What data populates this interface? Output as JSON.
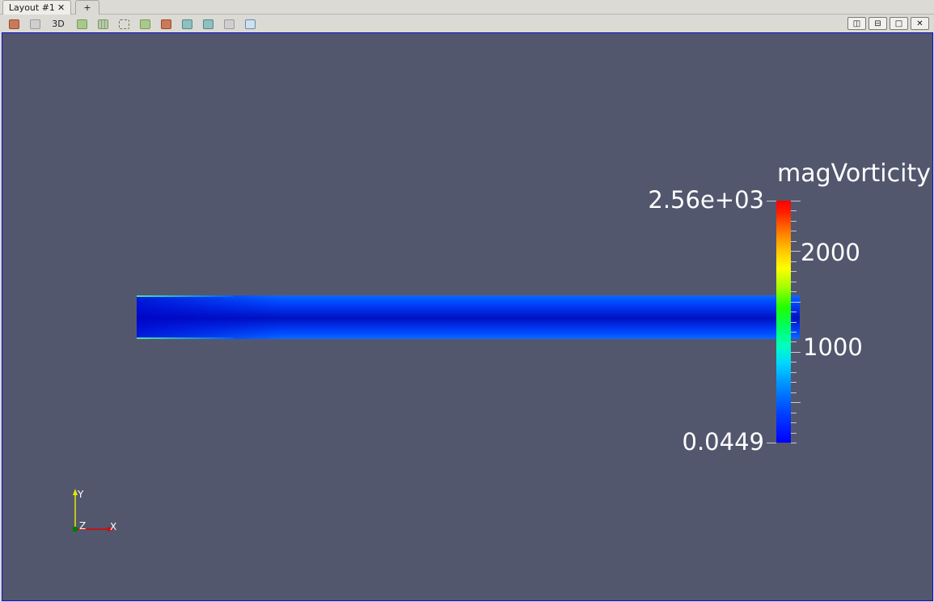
{
  "tabs": [
    {
      "label": "Layout #1",
      "close": "✕"
    },
    {
      "label": "+"
    }
  ],
  "toolbar": {
    "view_3d_label": "3D",
    "icons": [
      "reset-camera",
      "camera-undo",
      "show-center",
      "select-cells",
      "select-points",
      "frustum-cells",
      "frustum-points",
      "select-block",
      "interactive-select-cells",
      "interactive-select-points",
      "clear-selection",
      "grab-selection"
    ]
  },
  "window_controls": {
    "split_h": "◫",
    "split_v": "⊟",
    "maximize": "□",
    "close": "✕"
  },
  "scalar_bar": {
    "title": "magVorticity",
    "max_label": "2.56e+03",
    "label_2000": "2000",
    "label_1000": "1000",
    "min_label": "0.0449"
  },
  "axes": {
    "x": "X",
    "y": "Y",
    "z": "Z"
  },
  "colors": {
    "background": "#52576e",
    "active_frame": "#1010d0"
  }
}
